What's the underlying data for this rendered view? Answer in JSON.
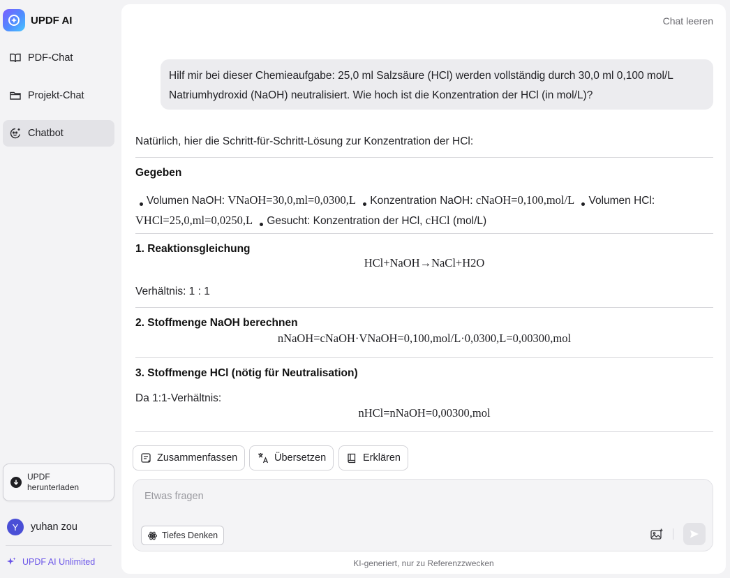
{
  "sidebar": {
    "brand": "UPDF AI",
    "items": [
      {
        "label": "PDF-Chat",
        "icon": "book-open-icon",
        "active": false
      },
      {
        "label": "Projekt-Chat",
        "icon": "folder-icon",
        "active": false
      },
      {
        "label": "Chatbot",
        "icon": "bot-face-icon",
        "active": true
      }
    ],
    "download_label": "UPDF herunterladen",
    "user": {
      "initial": "Y",
      "name": "yuhan zou"
    },
    "unlimited_label": "UPDF AI Unlimited"
  },
  "header": {
    "clear_chat": "Chat leeren"
  },
  "conversation": {
    "user_message": "Hilf mir bei dieser Chemieaufgabe: 25,0 ml Salzsäure (HCl) werden vollständig durch 30,0 ml 0,100 mol/L Natriumhydroxid (NaOH) neutralisiert. Wie hoch ist die Konzentration der HCl (in mol/L)?",
    "answer": {
      "intro": "Natürlich, hier die Schritt-für-Schritt-Lösung zur Konzentration der HCl:",
      "given_heading": "Gegeben",
      "given": [
        {
          "label": "Volumen NaOH:",
          "math": "VNaOH=30,0,ml=0,0300,L"
        },
        {
          "label": "Konzentration NaOH:",
          "math": "cNaOH=0,100,mol/L"
        },
        {
          "label": "Volumen HCl:",
          "math": "VHCl=25,0,ml=0,0250,L"
        },
        {
          "label": "Gesucht: Konzentration der HCl,",
          "math": "cHCl",
          "suffix": "(mol/L)"
        }
      ],
      "step1_heading": "1. Reaktionsgleichung",
      "step1_math": "HCl+NaOH→NaCl+H2O",
      "ratio_text": "Verhältnis: 1 : 1",
      "step2_heading": "2. Stoffmenge NaOH berechnen",
      "step2_math": "nNaOH=cNaOH·VNaOH=0,100,mol/L·0,0300,L=0,00300,mol",
      "step3_heading": "3. Stoffmenge HCl (nötig für Neutralisation)",
      "step3_text": "Da 1:1-Verhältnis:",
      "step3_math": "nHCl=nNaOH=0,00300,mol"
    }
  },
  "actions": [
    {
      "label": "Zusammenfassen",
      "icon": "summarize-icon"
    },
    {
      "label": "Übersetzen",
      "icon": "translate-icon"
    },
    {
      "label": "Erklären",
      "icon": "book-icon"
    }
  ],
  "input": {
    "placeholder": "Etwas fragen",
    "deep_thinking_label": "Tiefes Denken"
  },
  "footer": {
    "disclaimer": "KI-generiert, nur zu Referenzzwecken"
  }
}
